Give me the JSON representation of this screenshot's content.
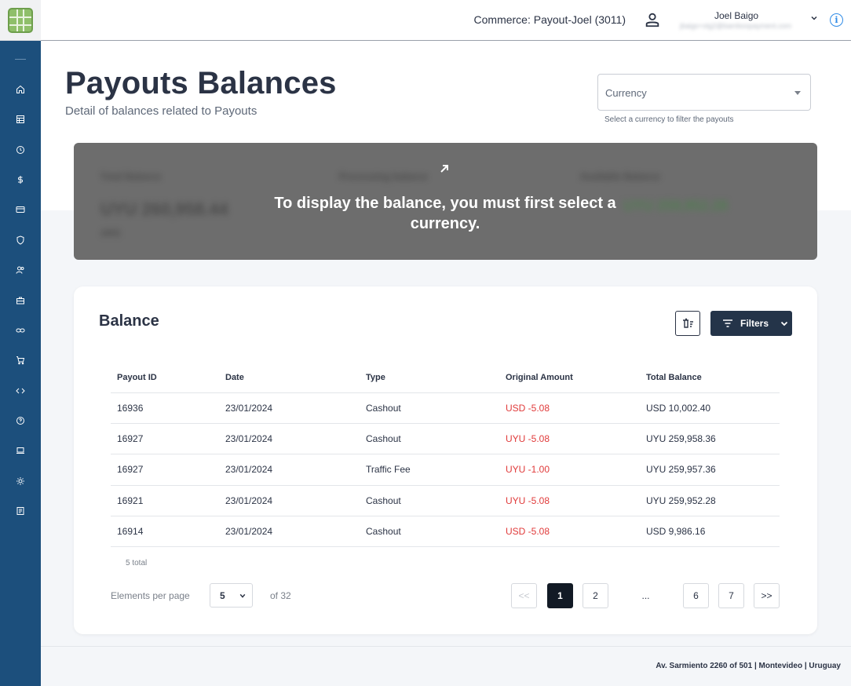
{
  "header": {
    "commerce": "Commerce: Payout-Joel (3011)",
    "user_name": "Joel Baigo",
    "user_email": "jbaigo+stg2@bamboopayment.com"
  },
  "page": {
    "title": "Payouts Balances",
    "subtitle": "Detail of balances related to Payouts"
  },
  "currency_filter": {
    "placeholder": "Currency",
    "helper": "Select a currency to filter the payouts"
  },
  "balance_overlay": {
    "message": "To display the balance, you must first select a currency.",
    "blurred": {
      "total_label": "Total Balance",
      "total_value": "UYU 260,958.44",
      "total_sub": "ARS",
      "processing_label": "Processing balance",
      "available_label": "Available Balance",
      "available_value": "UYU 259,952.28"
    }
  },
  "balance_table": {
    "title": "Balance",
    "filters_label": "Filters",
    "columns": [
      "Payout ID",
      "Date",
      "Type",
      "Original Amount",
      "Total Balance"
    ],
    "rows": [
      [
        "16936",
        "23/01/2024",
        "Cashout",
        "USD -5.08",
        "USD 10,002.40"
      ],
      [
        "16927",
        "23/01/2024",
        "Cashout",
        "UYU -5.08",
        "UYU 259,958.36"
      ],
      [
        "16927",
        "23/01/2024",
        "Traffic Fee",
        "UYU -1.00",
        "UYU 259,957.36"
      ],
      [
        "16921",
        "23/01/2024",
        "Cashout",
        "UYU -5.08",
        "UYU 259,952.28"
      ],
      [
        "16914",
        "23/01/2024",
        "Cashout",
        "USD -5.08",
        "USD 9,986.16"
      ]
    ],
    "total_text": "5 total",
    "elements_per_page_label": "Elements per page",
    "elements_per_page_value": "5",
    "of_total": "of 32"
  },
  "pagination": {
    "first": "<<",
    "pages": [
      "1",
      "2",
      "...",
      "6",
      "7"
    ],
    "last": ">>",
    "current": "1"
  },
  "footer": {
    "address": "Av. Sarmiento 2260 of 501 | Montevideo | Uruguay"
  },
  "colors": {
    "sidebar": "#1c4f7c",
    "primary_dark": "#243449",
    "negative": "#e03a3a",
    "info": "#2f8be6"
  }
}
